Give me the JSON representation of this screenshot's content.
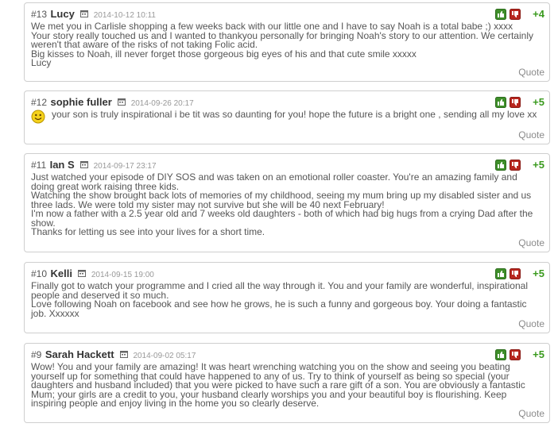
{
  "comments": [
    {
      "number": "#13",
      "author": "Lucy",
      "date": "2014-10-12 10:11",
      "score": "+4",
      "lines": [
        "We met you in Carlisle shopping a few weeks back with our little one and I have to say Noah is a total babe ;) xxxx",
        "Your story really touched us and I wanted to thankyou personally for bringing Noah's story to our attention. We certainly weren't that aware of the risks of not taking Folic acid.",
        "Big kisses to Noah, ill never forget those gorgeous big eyes of his and that cute smile xxxxx",
        "Lucy"
      ],
      "quote_label": "Quote"
    },
    {
      "number": "#12",
      "author": "sophie fuller",
      "date": "2014-09-26 20:17",
      "score": "+5",
      "smiley": true,
      "lines": [
        "your son is truly inspirational i be tit was so daunting for you! hope the future is a bright one , sending all my love xx"
      ],
      "quote_label": "Quote"
    },
    {
      "number": "#11",
      "author": "Ian S",
      "date": "2014-09-17 23:17",
      "score": "+5",
      "lines": [
        "Just watched your episode of DIY SOS and was taken on an emotional roller coaster. You're an amazing family and doing great work raising three kids.",
        "Watching the show brought back lots of memories of my childhood, seeing my mum bring up my disabled sister and us three lads. We were told my sister may not survive but she will be 40 next February!",
        "I'm now a father with a 2.5 year old and 7 weeks old daughters - both of which had big hugs from a crying Dad after the show.",
        "Thanks for letting us see into your lives for a short time."
      ],
      "quote_label": "Quote"
    },
    {
      "number": "#10",
      "author": "Kelli",
      "date": "2014-09-15 19:00",
      "score": "+5",
      "lines": [
        "Finally got to watch your programme and I cried all the way through it. You and your family are wonderful, inspirational people and deserved it so much.",
        "Love following Noah on facebook and see how he grows, he is such a funny and gorgeous boy. Your doing a fantastic job. Xxxxxx"
      ],
      "quote_label": "Quote"
    },
    {
      "number": "#9",
      "author": "Sarah Hackett",
      "date": "2014-09-02 05:17",
      "score": "+5",
      "lines": [
        "Wow! You and your family are amazing! It was heart wrenching watching you on the show and seeing you beating yourself up for something that could have happened to any of us. Try to think of yourself as being so special (your daughters and husband included) that you were picked to have such a rare gift of a son. You are obviously a fantastic Mum; your girls are a credit to you, your husband clearly worships you and your beautiful boy is flourishing. Keep inspiring people and enjoy living in the home you so clearly deserve."
      ],
      "quote_label": "Quote"
    }
  ],
  "colors": {
    "score": "#3a9a1e",
    "vote_up": "#3f8f2a",
    "vote_down": "#b8261e"
  },
  "icons": {
    "date": "calendar-icon",
    "up": "thumbs-up-icon",
    "down": "thumbs-down-icon",
    "emoji": "smiley-icon"
  }
}
